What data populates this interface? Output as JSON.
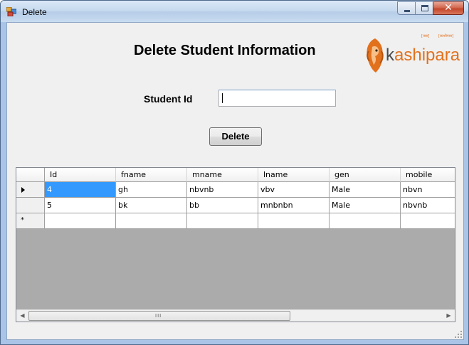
{
  "window": {
    "title": "Delete",
    "icon": "form-icon",
    "controls": {
      "minimize": "minimize-icon",
      "maximize": "maximize-icon",
      "close": "✕"
    }
  },
  "form": {
    "heading": "Delete Student Information",
    "student_id_label": "Student Id",
    "student_id_value": "",
    "delete_button": "Delete"
  },
  "logo": {
    "brand_k": "k",
    "brand_rest": "ashipara",
    "small_left": "[तारा]",
    "small_right": "[काशीपारा]",
    "accent": "#e2711d"
  },
  "grid": {
    "columns": [
      "Id",
      "fname",
      "mname",
      "lname",
      "gen",
      "mobile"
    ],
    "rows": [
      [
        "4",
        "gh",
        "nbvnb",
        "vbv",
        "Male",
        "nbvn"
      ],
      [
        "5",
        "bk",
        "bb",
        "mnbnbn",
        "Male",
        "nbvnb"
      ]
    ],
    "new_row_marker": "*",
    "current_row_marker": "row-arrow-icon",
    "selection_color": "#3399ff",
    "scroll_grip": "III"
  }
}
